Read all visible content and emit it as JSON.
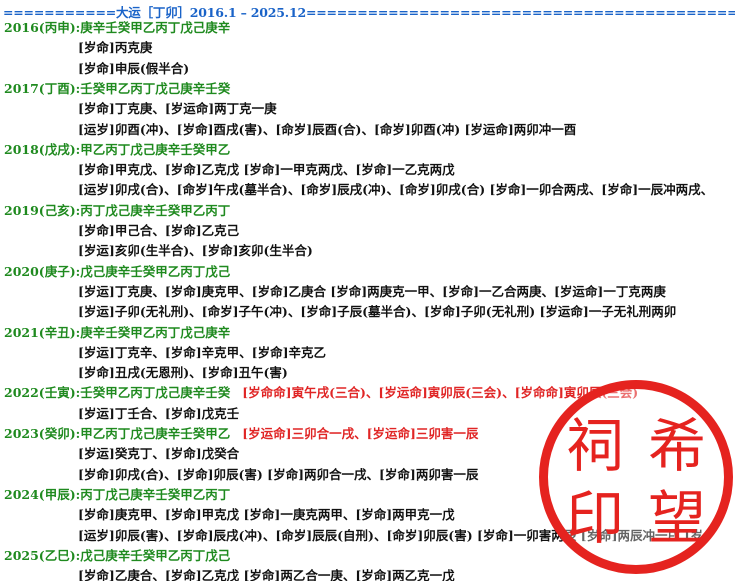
{
  "header": "===========大运［丁卯］2016.1 – 2025.12==================================================================",
  "years": [
    {
      "label": "2016(丙申):",
      "stems": "庚辛壬癸甲乙丙丁戊己庚辛",
      "extra": "",
      "lines": [
        "[岁命]丙克庚",
        "[岁命]申辰(假半合)"
      ]
    },
    {
      "label": "2017(丁酉):",
      "stems": "壬癸甲乙丙丁戊己庚辛壬癸",
      "extra": "",
      "lines": [
        "[岁命]丁克庚、[岁运命]两丁克一庚",
        "[运岁]卯酉(冲)、[岁命]酉戌(害)、[命岁]辰酉(合)、[命岁]卯酉(冲)  [岁运命]两卯冲一酉"
      ]
    },
    {
      "label": "2018(戊戌):",
      "stems": "甲乙丙丁戊己庚辛壬癸甲乙",
      "extra": "",
      "lines": [
        "[岁命]甲克戊、[岁命]乙克戊 [岁命]一甲克两戊、[岁命]一乙克两戊",
        "[运岁]卯戌(合)、[命岁]午戌(墓半合)、[命岁]辰戌(冲)、[命岁]卯戌(合)  [岁命]一卯合两戌、[岁命]一辰冲两戌、"
      ]
    },
    {
      "label": "2019(己亥):",
      "stems": "丙丁戊己庚辛壬癸甲乙丙丁",
      "extra": "",
      "lines": [
        "[岁命]甲己合、[岁命]乙克己",
        "[岁运]亥卯(生半合)、[岁命]亥卯(生半合)"
      ]
    },
    {
      "label": "2020(庚子):",
      "stems": "戊己庚辛壬癸甲乙丙丁戊己",
      "extra": "",
      "lines": [
        "[岁运]丁克庚、[岁命]庚克甲、[岁命]乙庚合 [岁命]两庚克一甲、[岁命]一乙合两庚、[岁运命]一丁克两庚",
        "[岁运]子卯(无礼刑)、[命岁]子午(冲)、[岁命]子辰(墓半合)、[岁命]子卯(无礼刑)  [岁运命]一子无礼刑两卯"
      ]
    },
    {
      "label": "2021(辛丑):",
      "stems": "庚辛壬癸甲乙丙丁戊己庚辛",
      "extra": "",
      "lines": [
        "[岁运]丁克辛、[岁命]辛克甲、[岁命]辛克乙",
        "[岁命]丑戌(无恩刑)、[岁命]丑午(害)"
      ]
    },
    {
      "label": "2022(壬寅):",
      "stems": "壬癸甲乙丙丁戊己庚辛壬癸",
      "extra": "[岁命命]寅午戌(三合)、[岁运命]寅卯辰(三会)、[岁命命]寅卯辰(三会)",
      "lines": [
        "[岁运]丁壬合、[岁命]戊克壬"
      ]
    },
    {
      "label": "2023(癸卯):",
      "stems": "甲乙丙丁戊己庚辛壬癸甲乙",
      "extra": "[岁运命]三卯合一戌、[岁运命]三卯害一辰",
      "lines": [
        "[岁运]癸克丁、[岁命]戊癸合",
        "[岁命]卯戌(合)、[岁命]卯辰(害)  [岁命]两卯合一戌、[岁命]两卯害一辰"
      ]
    },
    {
      "label": "2024(甲辰):",
      "stems": "丙丁戊己庚辛壬癸甲乙丙丁",
      "extra": "",
      "lines": [
        "[岁命]庚克甲、[岁命]甲克戊 [岁命]一庚克两甲、[岁命]两甲克一戊",
        "[运岁]卯辰(害)、[岁命]辰戌(冲)、[命岁]辰辰(自刑)、[命岁]卯辰(害)  [岁命]一卯害两辰 [岁命]两辰冲一戌  [岁"
      ]
    },
    {
      "label": "2025(乙巳):",
      "stems": "戊己庚辛壬癸甲乙丙丁戊己",
      "extra": "",
      "lines": [
        "[岁命]乙庚合、[岁命]乙克戊 [岁命]两乙合一庚、[岁命]两乙克一戊"
      ]
    }
  ],
  "seal": [
    "祠",
    "希",
    "印",
    "望"
  ],
  "colors": {
    "header": "#1a63c8",
    "year": "#1f8a1f",
    "text": "#111111",
    "highlight": "#e02525",
    "seal": "#e5231f"
  }
}
